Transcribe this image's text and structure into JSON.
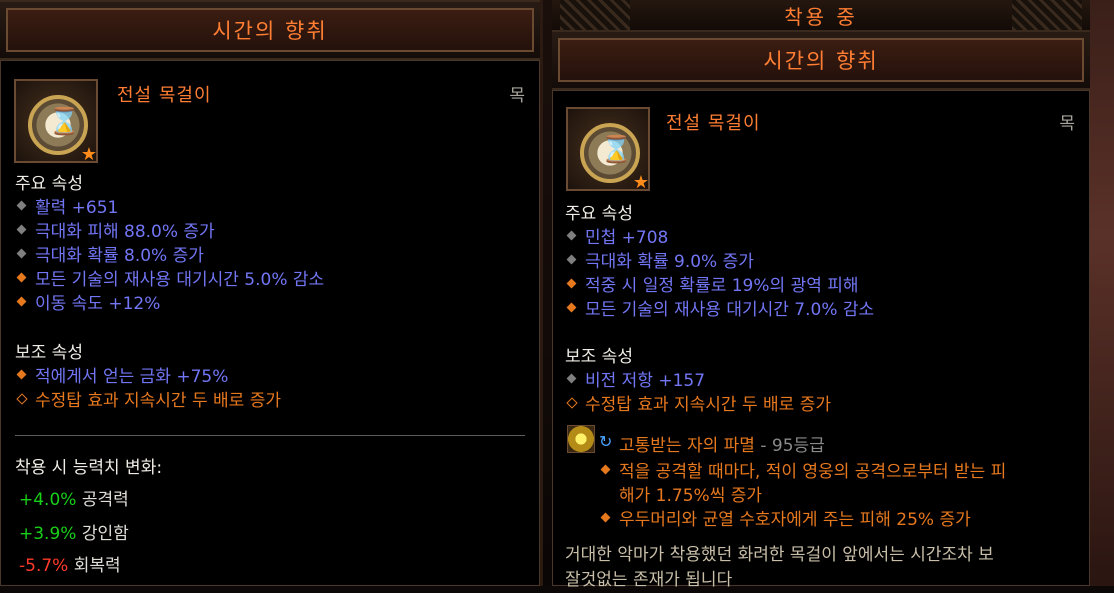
{
  "left": {
    "title": "시간의 향취",
    "item_type": "전설 목걸이",
    "slot": "목",
    "primary_header": "주요 속성",
    "primary": [
      {
        "text": "활력 +651",
        "bullet": "gray"
      },
      {
        "text": "극대화 피해 88.0% 증가",
        "bullet": "gray"
      },
      {
        "text": "극대화 확률 8.0% 증가",
        "bullet": "gray"
      },
      {
        "text": "모든 기술의 재사용 대기시간 5.0% 감소",
        "bullet": "orange"
      },
      {
        "text": "이동 속도 +12%",
        "bullet": "orange"
      }
    ],
    "secondary_header": "보조 속성",
    "secondary": [
      {
        "text": "적에게서 얻는 금화 +75%",
        "bullet": "orange"
      },
      {
        "text": "수정탑 효과 지속시간 두 배로 증가",
        "bullet": "orange-hollow"
      }
    ],
    "change_header": "착용 시 능력치 변화:",
    "changes": [
      {
        "value": "+4.0%",
        "label": "공격력"
      },
      {
        "value": "+3.9%",
        "label": "강인함"
      },
      {
        "value": "-5.7%",
        "label": "회복력"
      }
    ]
  },
  "right": {
    "equipped": "착용 중",
    "title": "시간의 향취",
    "item_type": "전설 목걸이",
    "slot": "목",
    "primary_header": "주요 속성",
    "primary": [
      {
        "text": "민첩 +708",
        "bullet": "gray"
      },
      {
        "text": "극대화 확률 9.0% 증가",
        "bullet": "gray"
      },
      {
        "text": "적중 시 일정 확률로 19%의 광역 피해",
        "bullet": "orange"
      },
      {
        "text": "모든 기술의 재사용 대기시간 7.0% 감소",
        "bullet": "orange"
      }
    ],
    "secondary_header": "보조 속성",
    "secondary": [
      {
        "text": "비전 저항 +157",
        "bullet": "gray"
      },
      {
        "text": "수정탑 효과 지속시간 두 배로 증가",
        "bullet": "orange-hollow"
      }
    ],
    "gem": {
      "name": "고통받는 자의 파멸",
      "rank": "- 95등급",
      "effects": [
        "적을 공격할 때마다, 적이 영웅의 공격으로부터 받는 피",
        "해가 1.75%씩 증가",
        "우두머리와 균열 수호자에게 주는 피해 25% 증가"
      ]
    },
    "flavor": [
      "거대한 악마가 착용했던 화려한 목걸이 앞에서는 시간조차 보",
      "잘것없는 존재가 됩니다"
    ]
  },
  "colors": {
    "legendary": "#ff7e33",
    "magic": "#7276f5",
    "positive": "#18d018",
    "negative": "#ff3a2a"
  }
}
